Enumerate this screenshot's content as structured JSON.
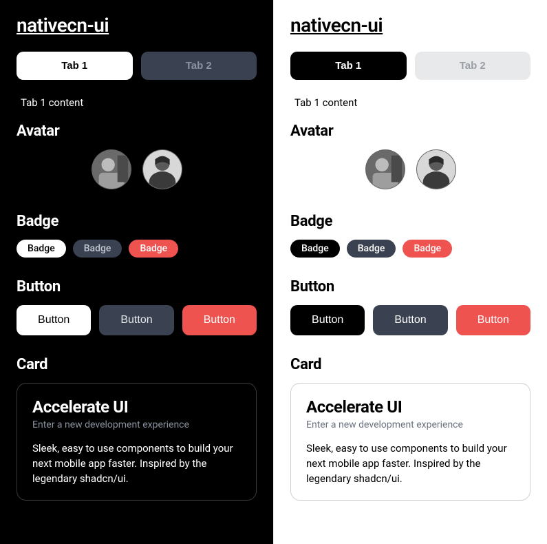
{
  "brand": "nativecn-ui",
  "tabs": [
    {
      "label": "Tab 1",
      "active": true
    },
    {
      "label": "Tab 2",
      "active": false
    }
  ],
  "tabContent": "Tab 1 content",
  "sections": {
    "avatar": "Avatar",
    "badge": "Badge",
    "button": "Button",
    "card": "Card"
  },
  "badges": [
    {
      "label": "Badge",
      "variant": "primary"
    },
    {
      "label": "Badge",
      "variant": "secondary"
    },
    {
      "label": "Badge",
      "variant": "destructive"
    }
  ],
  "buttons": [
    {
      "label": "Button",
      "variant": "primary"
    },
    {
      "label": "Button",
      "variant": "secondary"
    },
    {
      "label": "Button",
      "variant": "destructive"
    }
  ],
  "card": {
    "title": "Accelerate UI",
    "subtitle": "Enter a new development experience",
    "body": "Sleek, easy to use components to build your next mobile app faster. Inspired by the legendary shadcn/ui."
  },
  "colors": {
    "primaryDark": "#ffffff",
    "primaryLight": "#000000",
    "secondary": "#3a4150",
    "destructive": "#ef5350"
  }
}
